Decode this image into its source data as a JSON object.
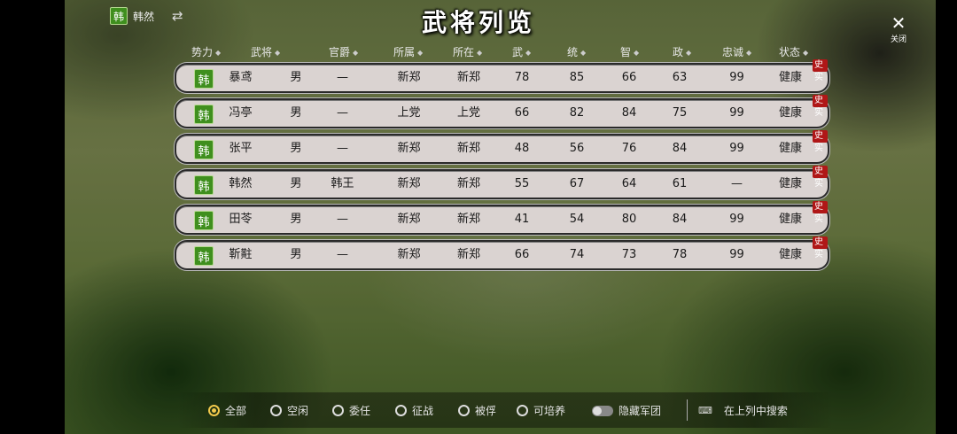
{
  "faction": {
    "badge": "韩",
    "name": "韩然",
    "swap_icon": "swap-arrows-icon"
  },
  "title": "武将列览",
  "close": {
    "icon": "close-icon",
    "label": "关闭"
  },
  "columns": [
    "势力",
    "武将",
    "官爵",
    "所属",
    "所在",
    "武",
    "统",
    "智",
    "政",
    "忠诚",
    "状态"
  ],
  "rows": [
    {
      "badge": "韩",
      "name": "暴鸢",
      "gender": "男",
      "rank": "—",
      "belong": "新郑",
      "location": "新郑",
      "wu": "78",
      "tong": "85",
      "zhi": "66",
      "zheng": "63",
      "loyalty": "99",
      "status": "健康",
      "tag": "史实"
    },
    {
      "badge": "韩",
      "name": "冯亭",
      "gender": "男",
      "rank": "—",
      "belong": "上党",
      "location": "上党",
      "wu": "66",
      "tong": "82",
      "zhi": "84",
      "zheng": "75",
      "loyalty": "99",
      "status": "健康",
      "tag": "史实"
    },
    {
      "badge": "韩",
      "name": "张平",
      "gender": "男",
      "rank": "—",
      "belong": "新郑",
      "location": "新郑",
      "wu": "48",
      "tong": "56",
      "zhi": "76",
      "zheng": "84",
      "loyalty": "99",
      "status": "健康",
      "tag": "史实"
    },
    {
      "badge": "韩",
      "name": "韩然",
      "gender": "男",
      "rank": "韩王",
      "belong": "新郑",
      "location": "新郑",
      "wu": "55",
      "tong": "67",
      "zhi": "64",
      "zheng": "61",
      "loyalty": "—",
      "status": "健康",
      "tag": "史实"
    },
    {
      "badge": "韩",
      "name": "田苓",
      "gender": "男",
      "rank": "—",
      "belong": "新郑",
      "location": "新郑",
      "wu": "41",
      "tong": "54",
      "zhi": "80",
      "zheng": "84",
      "loyalty": "99",
      "status": "健康",
      "tag": "史实"
    },
    {
      "badge": "韩",
      "name": "靳黈",
      "gender": "男",
      "rank": "—",
      "belong": "新郑",
      "location": "新郑",
      "wu": "66",
      "tong": "74",
      "zhi": "73",
      "zheng": "78",
      "loyalty": "99",
      "status": "健康",
      "tag": "史实"
    }
  ],
  "filters": {
    "options": [
      {
        "label": "全部",
        "selected": true
      },
      {
        "label": "空闲",
        "selected": false
      },
      {
        "label": "委任",
        "selected": false
      },
      {
        "label": "征战",
        "selected": false
      },
      {
        "label": "被俘",
        "selected": false
      },
      {
        "label": "可培养",
        "selected": false
      }
    ],
    "hide_army_label": "隐藏军团",
    "search_label": "在上列中搜索",
    "search_icon": "keyboard-icon"
  },
  "colors": {
    "faction_green": "#3f8f1e",
    "history_red": "#b01717",
    "row_bg": "#dad3d1"
  }
}
